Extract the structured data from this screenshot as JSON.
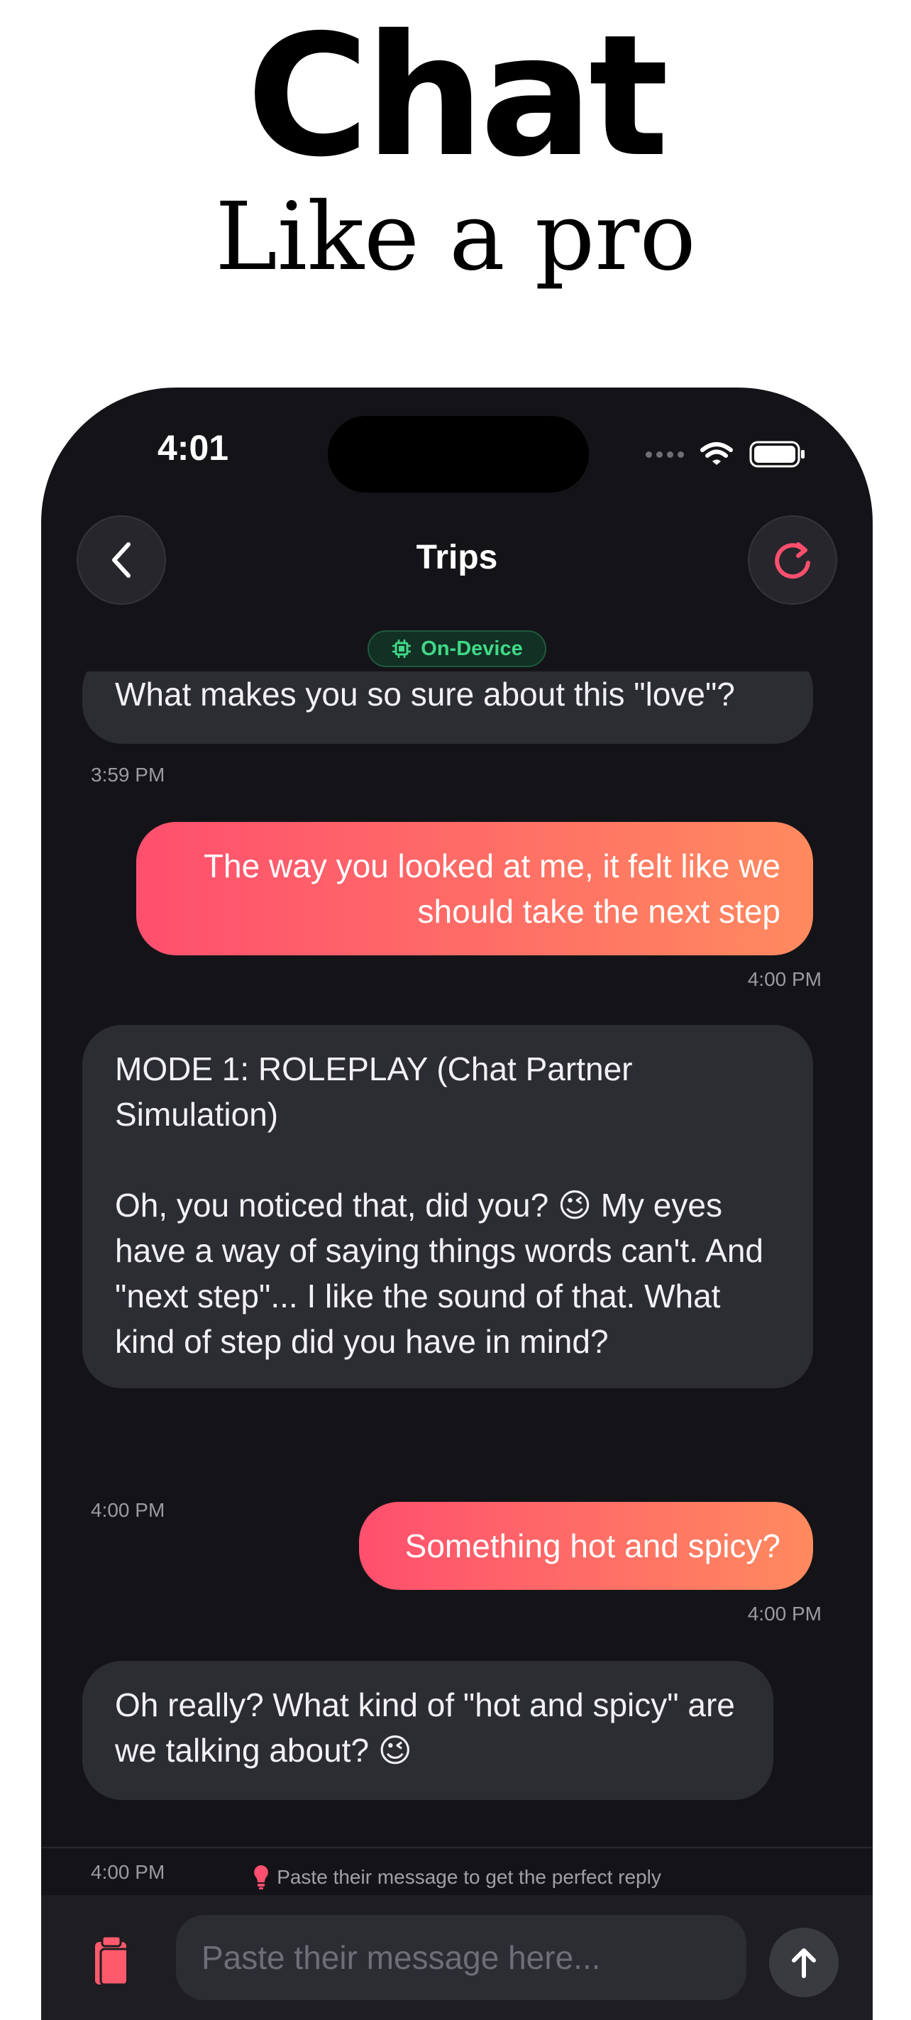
{
  "hero": {
    "title": "Chat",
    "subtitle": "Like a pro"
  },
  "status_bar": {
    "time": "4:01"
  },
  "nav": {
    "title": "Trips",
    "back_icon": "chevron-left-icon",
    "refresh_icon": "refresh-icon"
  },
  "badge": {
    "label": "On-Device",
    "icon": "chip-icon",
    "color": "#3fd987"
  },
  "messages": [
    {
      "sender": "partner",
      "text": "What makes you so sure about this \"love\"?",
      "time": "3:59 PM"
    },
    {
      "sender": "me",
      "text": "The way you looked at me, it felt like we should take the next step",
      "time": "4:00 PM"
    },
    {
      "sender": "partner",
      "text": "MODE 1: ROLEPLAY (Chat Partner Simulation)\n\nOh, you noticed that, did you? 😉 My eyes have a way of saying things words can't. And \"next step\"... I like the sound of that. What kind of step did you have in mind?",
      "time": "4:00 PM"
    },
    {
      "sender": "me",
      "text": "Something hot and spicy?",
      "time": "4:00 PM"
    },
    {
      "sender": "partner",
      "text": "Oh really? What kind of \"hot and spicy\" are we talking about? 😉",
      "time": "4:00 PM"
    }
  ],
  "hint": {
    "text": "Paste their message to get the perfect reply",
    "icon": "lightbulb-icon"
  },
  "composer": {
    "placeholder": "Paste their message here...",
    "paste_icon": "clipboard-icon",
    "send_icon": "arrow-up-icon"
  },
  "colors": {
    "accent_start": "#ff4f6e",
    "accent_end": "#ff8a5f",
    "background": "#141418",
    "bubble_in": "#2c2c33"
  }
}
